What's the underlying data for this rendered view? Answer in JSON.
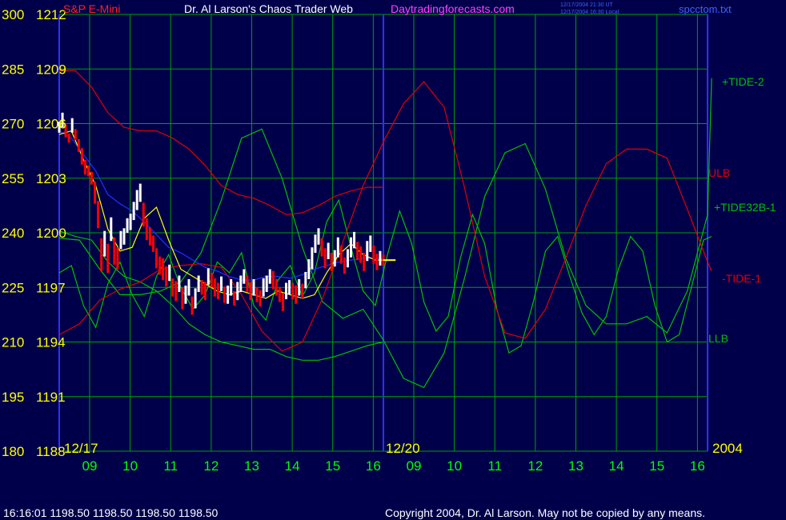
{
  "header": {
    "symbol_title": "S&P E-Mini",
    "author_title": "Dr. Al Larson's Chaos Trader Web",
    "site": "Daytradingforecasts.com",
    "timestamp_ut": "12/17/2004 21:30 UT",
    "timestamp_local": "12/17/2004 16:30 Local",
    "filename": "spcctom.txt"
  },
  "footer": {
    "quote": "16:16:01  1198.50 1198.50 1198.50 1198.50",
    "copyright": "Copyright 2004, Dr. Al Larson. May not be copied by any means."
  },
  "colors": {
    "background": "#00004a",
    "grid": "#00a000",
    "axis_label": "#ffff00",
    "time_label": "#00ff00",
    "date_label": "#ffff00",
    "title": "#ffffff",
    "symbol": "#ff2020",
    "site": "#ff40ff",
    "filename": "#4060ff",
    "ulb": "#e00000",
    "llb": "#00c000",
    "tide2": "#00c000",
    "tide32b": "#00c000",
    "tide1": "#e00000",
    "vline": "#3030ff",
    "price_up": "#ffffff",
    "price_down": "#ff0000",
    "avg": "#ffff00",
    "blue_line": "#2030ff"
  },
  "chart_data": {
    "type": "line",
    "ylim_price": [
      1188,
      1212
    ],
    "ylim_index": [
      180,
      300
    ],
    "y_ticks_index": [
      300,
      285,
      270,
      255,
      240,
      225,
      210,
      195,
      180
    ],
    "y_ticks_price": [
      "1212",
      "1209",
      "1206",
      "1203",
      "1200",
      "1197",
      "1194",
      "1191",
      "1188"
    ],
    "x_tick_labels": [
      "09",
      "10",
      "11",
      "12",
      "13",
      "14",
      "15",
      "16",
      "09",
      "10",
      "11",
      "12",
      "13",
      "14",
      "15",
      "16"
    ],
    "date_labels": [
      "12/17",
      "12/20",
      "2004"
    ],
    "series": [
      {
        "name": "+TIDE-2",
        "color_key": "tide2",
        "t": [
          0,
          0.5,
          1,
          1.5,
          2,
          2.5,
          3,
          3.5,
          4,
          4.5,
          5,
          5.5,
          6,
          6.5,
          7,
          7.5,
          8,
          8.5,
          9,
          9.5,
          10,
          10.5,
          11,
          11.5,
          12,
          12.5,
          13,
          13.5,
          14,
          14.5,
          15,
          15.5,
          16,
          16.1
        ],
        "v": [
          1199.7,
          1199.6,
          1198.0,
          1196.6,
          1196.6,
          1196.8,
          1197.3,
          1198.9,
          1201.8,
          1205.2,
          1205.7,
          1203.0,
          1199.2,
          1196.2,
          1195.3,
          1195.8,
          1194.1,
          1192.0,
          1191.5,
          1193.4,
          1197.5,
          1202.0,
          1204.4,
          1204.9,
          1202.4,
          1198.6,
          1196.0,
          1195.0,
          1195.0,
          1195.4,
          1194.5,
          1196.8,
          1201.0,
          1208.5
        ]
      },
      {
        "name": "+TIDE32B-1",
        "color_key": "tide32b",
        "t": [
          0,
          0.3,
          0.6,
          0.9,
          1.2,
          1.5,
          1.8,
          2.1,
          2.4,
          2.7,
          3.0,
          3.3,
          3.6,
          3.9,
          4.2,
          4.5,
          4.8,
          5.1,
          5.4,
          5.7,
          6.0,
          6.3,
          6.6,
          6.9,
          7.2,
          7.5,
          7.8,
          8.1,
          8.4,
          8.7,
          9.0,
          9.3,
          9.6,
          9.9,
          10.2,
          10.5,
          10.8,
          11.1,
          11.4,
          11.7,
          12.0,
          12.3,
          12.6,
          12.9,
          13.2,
          13.5,
          13.8,
          14.1,
          14.4,
          14.7,
          15.0,
          15.3,
          15.6,
          15.9,
          16.1
        ],
        "v": [
          1197.8,
          1198.2,
          1196.0,
          1194.8,
          1197.2,
          1198.4,
          1196.6,
          1195.4,
          1197.6,
          1198.8,
          1197.0,
          1195.8,
          1196.6,
          1198.4,
          1197.8,
          1198.9,
          1196.0,
          1195.2,
          1197.4,
          1198.2,
          1196.5,
          1197.8,
          1200.6,
          1201.8,
          1199.2,
          1196.8,
          1196.0,
          1198.8,
          1201.2,
          1199.4,
          1196.2,
          1194.6,
          1195.4,
          1198.6,
          1201.0,
          1199.4,
          1195.8,
          1193.4,
          1193.8,
          1196.2,
          1199.0,
          1199.8,
          1197.6,
          1195.6,
          1194.4,
          1195.4,
          1198.0,
          1199.8,
          1199.0,
          1196.0,
          1194.0,
          1194.4,
          1197.0,
          1199.6,
          1199.8
        ]
      },
      {
        "name": "ULB",
        "color_key": "ulb",
        "t": [
          0,
          0.4,
          0.8,
          1.2,
          1.6,
          2.0,
          2.4,
          2.8,
          3.2,
          3.6,
          4.0,
          4.4,
          4.8,
          5.2,
          5.6,
          6.0,
          6.4,
          6.8,
          7.2,
          7.6,
          7.99
        ],
        "v": [
          1208.9,
          1208.9,
          1208.0,
          1206.6,
          1205.8,
          1205.6,
          1205.6,
          1205.2,
          1204.6,
          1203.7,
          1202.6,
          1202.1,
          1201.9,
          1201.5,
          1201.0,
          1201.1,
          1201.5,
          1202.0,
          1202.3,
          1202.5,
          1202.5
        ]
      },
      {
        "name": "LLB",
        "color_key": "llb",
        "t": [
          0,
          0.4,
          0.8,
          1.2,
          1.6,
          2.0,
          2.4,
          2.8,
          3.2,
          3.6,
          4.0,
          4.4,
          4.8,
          5.2,
          5.6,
          6.0,
          6.4,
          6.8,
          7.2,
          7.6,
          7.99
        ],
        "v": [
          1200.1,
          1199.8,
          1199.6,
          1198.4,
          1197.6,
          1197.3,
          1196.8,
          1196.0,
          1195.0,
          1194.4,
          1194.0,
          1193.8,
          1193.6,
          1193.6,
          1193.2,
          1193.0,
          1193.0,
          1193.2,
          1193.5,
          1193.8,
          1194.0
        ]
      },
      {
        "name": "-TIDE-1",
        "color_key": "tide1",
        "t": [
          0,
          0.5,
          1,
          1.5,
          2,
          2.5,
          3,
          3.5,
          4,
          4.5,
          5,
          5.5,
          6,
          6.5,
          7,
          7.5,
          8,
          8.5,
          9,
          9.5,
          10,
          10.5,
          11,
          11.5,
          12,
          12.5,
          13,
          13.5,
          14,
          14.5,
          15,
          15.5,
          16,
          16.1
        ],
        "v": [
          1194.4,
          1195.0,
          1196.3,
          1196.9,
          1197.3,
          1198.0,
          1198.2,
          1198.3,
          1198.1,
          1196.6,
          1194.6,
          1193.5,
          1194.0,
          1196.4,
          1199.5,
          1202.6,
          1205.0,
          1207.1,
          1208.3,
          1206.9,
          1202.5,
          1197.6,
          1194.5,
          1194.2,
          1195.8,
          1198.6,
          1201.5,
          1203.8,
          1204.6,
          1204.6,
          1204.1,
          1201.3,
          1198.4,
          1197.9
        ]
      },
      {
        "name": "",
        "color_key": "blue_line",
        "t": [
          0,
          0.3,
          0.6,
          0.9,
          1.2,
          1.5,
          1.8,
          2.1,
          2.4,
          2.7,
          3.0,
          3.3,
          3.6,
          3.9,
          4.2,
          4.5,
          4.8,
          5.1,
          5.4,
          5.7,
          6.0,
          6.3,
          6.6,
          6.9,
          7.2,
          7.5,
          7.99
        ],
        "v": [
          1205.6,
          1205.2,
          1204.3,
          1203.4,
          1202.1,
          1201.6,
          1201.2,
          1200.6,
          1199.9,
          1199.2,
          1198.9,
          1198.5,
          1198.1,
          1197.9,
          1197.6,
          1197.4,
          1197.4,
          1197.6,
          1197.6,
          1197.5,
          1197.7,
          1198.0,
          1198.2,
          1198.4,
          1198.5,
          1198.6,
          1198.6
        ]
      },
      {
        "name": "",
        "color_key": "avg",
        "t": [
          0,
          0.3,
          0.6,
          0.9,
          1.2,
          1.5,
          1.8,
          2.1,
          2.4,
          2.7,
          3.0,
          3.3,
          3.6,
          3.9,
          4.2,
          4.5,
          4.8,
          5.1,
          5.4,
          5.7,
          6.0,
          6.3,
          6.6,
          6.9,
          7.2,
          7.5,
          7.8,
          8.0,
          8.3
        ],
        "v": [
          1205.4,
          1205.6,
          1204.0,
          1202.6,
          1200.2,
          1199.0,
          1199.2,
          1200.8,
          1201.4,
          1199.6,
          1198.0,
          1197.6,
          1197.2,
          1196.8,
          1196.6,
          1196.8,
          1196.6,
          1196.4,
          1196.8,
          1196.6,
          1196.4,
          1196.6,
          1197.8,
          1198.8,
          1199.4,
          1198.8,
          1198.5,
          1198.5,
          1198.5
        ]
      }
    ],
    "price_bars": {
      "t": [
        0,
        0.08,
        0.16,
        0.24,
        0.32,
        0.4,
        0.48,
        0.56,
        0.64,
        0.72,
        0.8,
        0.88,
        0.96,
        1.04,
        1.12,
        1.2,
        1.28,
        1.36,
        1.44,
        1.52,
        1.6,
        1.68,
        1.76,
        1.84,
        1.92,
        2.0,
        2.08,
        2.16,
        2.24,
        2.32,
        2.4,
        2.48,
        2.56,
        2.64,
        2.72,
        2.8,
        2.88,
        2.96,
        3.04,
        3.12,
        3.2,
        3.28,
        3.36,
        3.44,
        3.52,
        3.6,
        3.68,
        3.76,
        3.84,
        3.92,
        4.0,
        4.08,
        4.16,
        4.24,
        4.32,
        4.4,
        4.48,
        4.56,
        4.64,
        4.72,
        4.8,
        4.88,
        4.96,
        5.04,
        5.12,
        5.2,
        5.28,
        5.36,
        5.44,
        5.52,
        5.6,
        5.68,
        5.76,
        5.84,
        5.92,
        6.0,
        6.08,
        6.16,
        6.24,
        6.32,
        6.4,
        6.48,
        6.56,
        6.64,
        6.72,
        6.8,
        6.88,
        6.96,
        7.04,
        7.12,
        7.2,
        7.28,
        7.36,
        7.44,
        7.52,
        7.6,
        7.68,
        7.76,
        7.84,
        7.92,
        8.0
      ],
      "v": [
        1205.8,
        1206.2,
        1205.6,
        1205.2,
        1205.9,
        1205.4,
        1204.8,
        1204.2,
        1203.6,
        1203.4,
        1203.0,
        1202.2,
        1201.0,
        1198.8,
        1199.4,
        1198.6,
        1200.2,
        1199.0,
        1198.6,
        1199.6,
        1199.8,
        1200.4,
        1200.6,
        1201.2,
        1201.8,
        1202.2,
        1201.0,
        1200.2,
        1199.8,
        1199.4,
        1198.6,
        1198.2,
        1198.0,
        1197.6,
        1197.8,
        1197.0,
        1196.8,
        1197.2,
        1196.4,
        1196.6,
        1197.0,
        1196.0,
        1196.4,
        1197.2,
        1197.0,
        1196.8,
        1197.6,
        1197.4,
        1197.0,
        1196.8,
        1197.2,
        1196.6,
        1196.6,
        1197.0,
        1196.4,
        1196.8,
        1197.2,
        1197.6,
        1197.2,
        1196.8,
        1197.0,
        1196.6,
        1196.4,
        1197.0,
        1197.2,
        1197.6,
        1197.4,
        1197.0,
        1196.6,
        1196.2,
        1196.8,
        1197.0,
        1196.8,
        1196.6,
        1197.0,
        1196.8,
        1197.4,
        1198.0,
        1198.6,
        1199.4,
        1199.8,
        1199.2,
        1198.6,
        1199.0,
        1198.4,
        1198.6,
        1199.2,
        1198.8,
        1198.2,
        1198.6,
        1199.2,
        1199.6,
        1199.0,
        1198.8,
        1198.4,
        1199.0,
        1199.4,
        1198.8,
        1198.4,
        1198.6,
        1198.5
      ],
      "range": [
        0.6,
        0.8,
        0.7,
        0.5,
        0.8,
        0.6,
        0.7,
        0.9,
        0.8,
        0.6,
        0.7,
        1.2,
        1.5,
        1.8,
        1.4,
        1.6,
        1.3,
        1.5,
        1.2,
        1.0,
        0.9,
        0.8,
        0.9,
        1.0,
        1.1,
        1.0,
        1.3,
        1.2,
        1.0,
        0.9,
        1.1,
        1.0,
        1.2,
        1.1,
        0.9,
        1.0,
        1.1,
        0.9,
        1.2,
        1.0,
        0.9,
        1.0,
        1.1,
        0.9,
        0.8,
        1.0,
        0.9,
        0.8,
        1.0,
        0.9,
        0.8,
        0.9,
        1.0,
        0.9,
        0.8,
        1.0,
        0.9,
        0.8,
        0.9,
        1.0,
        0.9,
        0.8,
        0.9,
        1.0,
        0.9,
        0.8,
        1.0,
        0.9,
        0.8,
        1.0,
        0.9,
        0.8,
        0.9,
        1.0,
        0.9,
        0.8,
        0.9,
        1.1,
        1.2,
        1.0,
        0.9,
        1.0,
        1.1,
        0.9,
        1.0,
        0.9,
        1.1,
        1.0,
        0.9,
        1.0,
        1.1,
        0.9,
        1.0,
        0.9,
        1.0,
        1.1,
        0.9,
        1.0,
        0.9,
        0.8,
        0.6
      ]
    },
    "last_price_marker": {
      "t_start": 7.99,
      "t_end": 8.3,
      "v": 1198.5
    },
    "labels": [
      {
        "text": "+TIDE-2",
        "color_key": "tide2"
      },
      {
        "text": "ULB",
        "color_key": "ulb"
      },
      {
        "text": "+TIDE32B-1",
        "color_key": "tide32b"
      },
      {
        "text": "-TIDE-1",
        "color_key": "tide1"
      },
      {
        "text": "LLB",
        "color_key": "llb"
      }
    ],
    "grid": true
  }
}
